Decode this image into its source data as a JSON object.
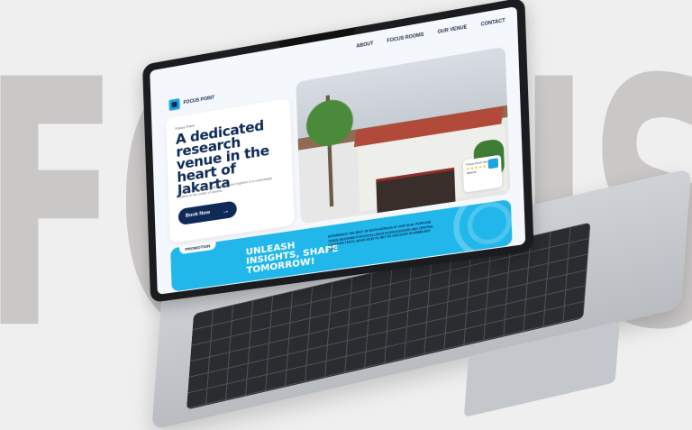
{
  "background": {
    "word": "FOCUS POINT",
    "color": "#cac7c7"
  },
  "nav": {
    "items": [
      "ABOUT",
      "FOCUS ROOMS",
      "OUR VENUE",
      "CONTACT"
    ]
  },
  "brand": {
    "name": "FOCUS POINT",
    "accent": "#1aa6e0",
    "primary": "#0f2a57"
  },
  "hero": {
    "eyebrow": "Focus Point",
    "headline": "A dedicated research venue in the heart of Jakarta",
    "description": "A venue where research and focus come together in a comfortable location in the center of Jakarta.",
    "cta_label": "Book Now",
    "cta_arrow": "→"
  },
  "photo_badge": {
    "title": "Focus Point Venue",
    "rating_stars": "★★★★★",
    "subtitle": "Jakarta"
  },
  "promotion": {
    "tab_label": "PROMOTION",
    "title": "UNLEASH INSIGHTS, SHAPE TOMORROW!",
    "body": "EXPERIENCE THE BEST OF BOTH WORLDS AT OUR DUAL PURPOSE VENUE DESIGNED FOR EXCELLENCE IN DISCUSSIONS AND CENTRAL LOCATION TESTS. BOOK NOW TO GET 5% DISCOUNT IN FEBRUARY 2024"
  }
}
